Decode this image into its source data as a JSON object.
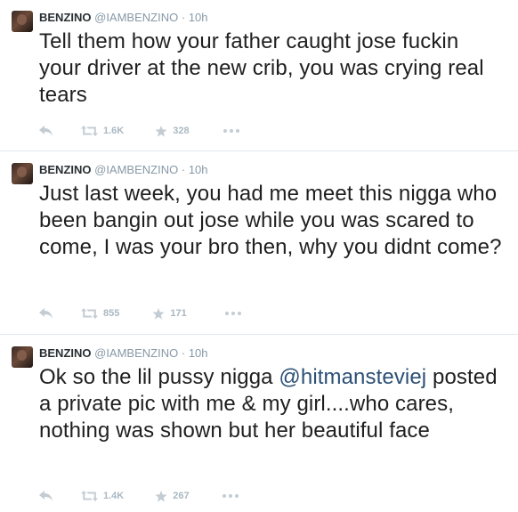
{
  "tweets": [
    {
      "name": "BENZINO",
      "handle": "@IAMBENZINO",
      "separator": "·",
      "time": "10h",
      "text": "Tell them how your father caught jose fuckin your driver at the new crib, you was crying real tears",
      "retweets": "1.6K",
      "favorites": "328"
    },
    {
      "name": "BENZINO",
      "handle": "@IAMBENZINO",
      "separator": "·",
      "time": "10h",
      "text": "Just last week, you had me meet this nigga who been bangin out jose while you was scared to come, I was your bro then, why you didnt come?",
      "retweets": "855",
      "favorites": "171"
    },
    {
      "name": "BENZINO",
      "handle": "@IAMBENZINO",
      "separator": "·",
      "time": "10h",
      "text_before": "Ok so the lil pussy nigga ",
      "mention": "@hitmansteviej",
      "text_after": " posted a private pic with me & my girl....who cares, nothing was shown but her beautiful face",
      "retweets": "1.4K",
      "favorites": "267"
    }
  ],
  "colors": {
    "mention_link": "#2b4f76",
    "meta_gray": "#8899a6",
    "action_gray": "#aab8c2",
    "divider": "#e1e8ed"
  },
  "icons": {
    "reply": "reply-icon",
    "retweet": "retweet-icon",
    "favorite": "star-icon",
    "more": "more-dots-icon"
  }
}
